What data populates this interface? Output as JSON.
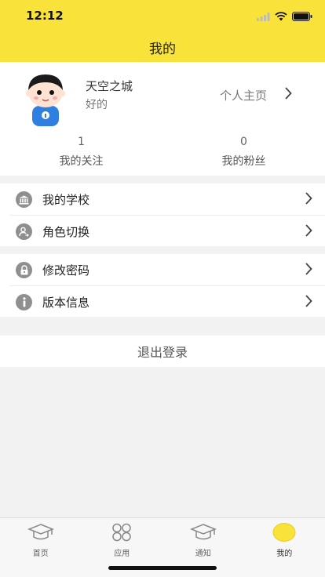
{
  "status_bar": {
    "time": "12:12"
  },
  "header": {
    "title": "我的"
  },
  "profile": {
    "name": "天空之城",
    "subtitle": "好的",
    "homepage_label": "个人主页",
    "following": {
      "count": "1",
      "label": "我的关注"
    },
    "fans": {
      "count": "0",
      "label": "我的粉丝"
    }
  },
  "menu_group_1": [
    {
      "label": "我的学校",
      "icon": "bank-icon"
    },
    {
      "label": "角色切换",
      "icon": "user-switch-icon"
    }
  ],
  "menu_group_2": [
    {
      "label": "修改密码",
      "icon": "lock-icon"
    },
    {
      "label": "版本信息",
      "icon": "info-icon"
    }
  ],
  "logout_label": "退出登录",
  "tabbar": {
    "tabs": [
      {
        "label": "首页",
        "icon": "graduation-cap-icon"
      },
      {
        "label": "应用",
        "icon": "apps-grid-icon"
      },
      {
        "label": "通知",
        "icon": "graduation-cap-icon"
      },
      {
        "label": "我的",
        "icon": "profile-circle-icon"
      }
    ],
    "active_index": 3
  },
  "colors": {
    "accent": "#F9E23A",
    "active_tab": "#F9E23A",
    "background": "#F2F2F2"
  }
}
